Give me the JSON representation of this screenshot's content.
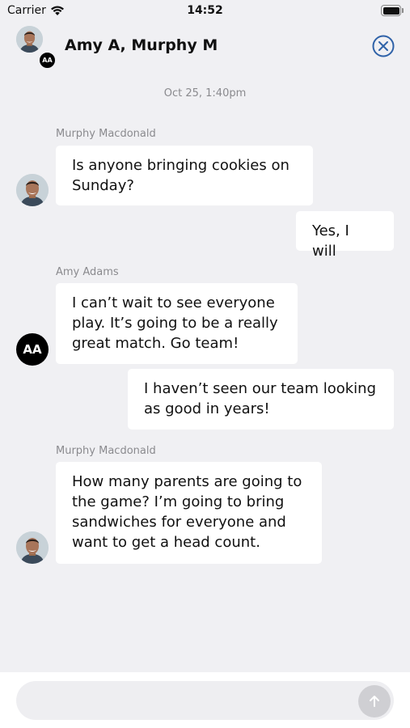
{
  "status_bar": {
    "carrier": "Carrier",
    "time": "14:52",
    "wifi_icon": "wifi-icon",
    "battery_icon": "battery-icon"
  },
  "header": {
    "title": "Amy A, Murphy M",
    "avatar_badge": "AA",
    "close_icon": "close-circle-icon",
    "accent_color": "#2f62a8"
  },
  "timestamp": "Oct 25, 1:40pm",
  "messages": [
    {
      "sender": "Murphy Macdonald",
      "direction": "incoming",
      "text": "Is anyone bringing cookies on Sunday?"
    },
    {
      "sender": "",
      "direction": "outgoing",
      "text": "Yes, I will"
    },
    {
      "sender": "Amy Adams",
      "direction": "incoming",
      "avatar_initials": "AA",
      "text": "I can’t wait to see everyone play. It’s going to be a really great match. Go team!"
    },
    {
      "sender": "",
      "direction": "outgoing",
      "text": "I haven’t seen our team looking as good in years!"
    },
    {
      "sender": "Murphy Macdonald",
      "direction": "incoming",
      "text": "How many parents are going to the game? I’m going to bring sandwiches for everyone and want to get a head count."
    }
  ],
  "composer": {
    "input_value": "",
    "input_placeholder": "",
    "send_icon": "arrow-up-icon"
  }
}
